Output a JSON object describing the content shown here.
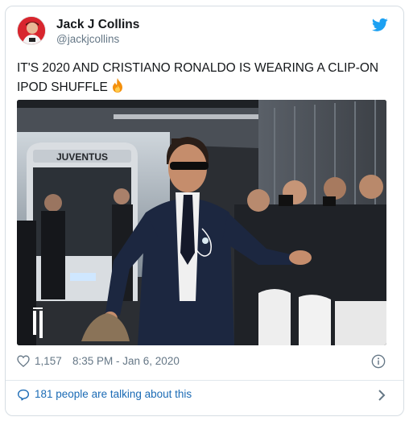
{
  "tweet": {
    "author_name": "Jack J Collins",
    "author_handle": "@jackjcollins",
    "text": "IT'S 2020 AND CRISTIANO RONALDO IS WEARING A CLIP-ON IPOD SHUFFLE",
    "emoji": "fire-emoji",
    "like_count": "1,157",
    "timestamp": "8:35 PM - Jan 6, 2020",
    "conversation_label": "181 people are talking about this"
  },
  "photo": {
    "bus_sign": "JUVENTUS"
  },
  "icons": {
    "brand": "twitter-bird-icon",
    "like": "heart-icon",
    "info": "info-icon",
    "conversation": "speech-bubble-icon",
    "more": "chevron-right-icon"
  },
  "colors": {
    "twitter_blue": "#1da1f2",
    "link_blue": "#1b6bb5",
    "secondary_text": "#657786",
    "border": "#d6dde3"
  }
}
